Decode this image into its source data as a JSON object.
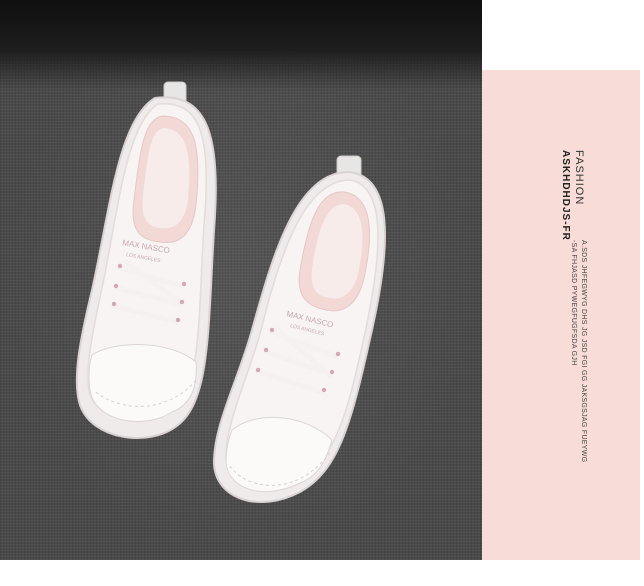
{
  "product_image": {
    "subject": "white-sneakers-photo",
    "colors": {
      "background": "#ffffff",
      "accent_panel": "#f7dcd8",
      "fabric": "#4a4a4a",
      "shoe": "#f6f3f2"
    }
  },
  "side_label": {
    "title": "FASHION",
    "brand": "ASKHDHDJS-FR",
    "lines": [
      "A.SDS JHFEGWYG DHS JG JSD FGI GG JAKSGSJAG FUEYWG",
      "-SA FHJASD PYWEGFUGFSDA GJH"
    ]
  },
  "shoe_print": {
    "left_brand": "MAX NASCO",
    "left_sub": "LOS ANGELES",
    "right_brand": "MAX NASCO",
    "right_sub": "LOS ANGELES"
  }
}
